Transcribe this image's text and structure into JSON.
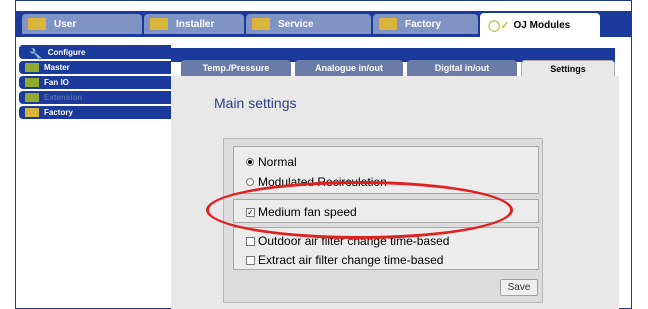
{
  "top_tabs": [
    {
      "label": "User"
    },
    {
      "label": "Installer"
    },
    {
      "label": "Service"
    },
    {
      "label": "Factory"
    },
    {
      "label": "OJ Modules"
    }
  ],
  "left_nav": [
    {
      "label": "Configure"
    },
    {
      "label": "Master"
    },
    {
      "label": "Fan IO"
    },
    {
      "label": "Extension"
    },
    {
      "label": "Factory"
    }
  ],
  "sub_tabs": [
    {
      "label": "Temp./Pressure"
    },
    {
      "label": "Analogue in/out"
    },
    {
      "label": "Digital in/out"
    },
    {
      "label": "Settings"
    }
  ],
  "main": {
    "title": "Main settings",
    "options": {
      "normal": "Normal",
      "modulated": "Modulated Recirculation",
      "medium_fan": "Medium fan speed",
      "outdoor_filter": "Outdoor air filter change time-based",
      "extract_filter": "Extract air filter change time-based"
    },
    "selected_mode": "Normal",
    "medium_fan_checked": true,
    "save_label": "Save"
  },
  "colors": {
    "nav_blue": "#1b3a9c",
    "highlight_ellipse": "#e0201f"
  }
}
